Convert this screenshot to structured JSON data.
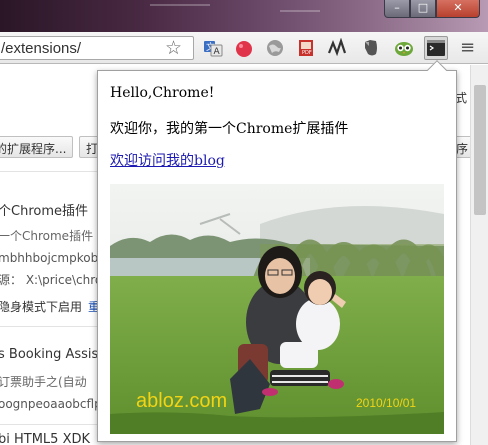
{
  "browser": {
    "url_text": "/extensions/",
    "star_glyph": "☆",
    "menu_glyph": "≡",
    "window_buttons": {
      "minimize": "–",
      "maximize": "□",
      "close": "✕"
    },
    "extension_icons": [
      "translate-icon",
      "red-drop-icon",
      "globe-icon",
      "red-book-icon",
      "vector-icon",
      "evernote-icon",
      "owl-icon",
      "terminal-icon"
    ]
  },
  "background_page": {
    "right_char": "式",
    "buttons": [
      "的扩展程序...",
      "打",
      "序"
    ],
    "items": [
      {
        "title": "个Chrome插件",
        "desc": "一个Chrome插件",
        "id": "mbhhbojcmpkoblcn",
        "source": "源：  X:\\price\\chrom",
        "incognito": "隐身模式下启用",
        "link": "重"
      },
      {
        "title": "s Booking Assista",
        "desc": "订票助手之(自动",
        "id": "oognpeoaaobcflpin"
      },
      {
        "title": "bi HTML5 XDK"
      }
    ]
  },
  "popup": {
    "hello": "Hello,Chrome!",
    "welcome": "欢迎你，我的第一个Chrome扩展插件",
    "blog_link": "欢迎访问我的blog",
    "photo": {
      "watermark": "abloz.com",
      "date_stamp": "2010/10/01"
    }
  },
  "colors": {
    "link": "#1c1ab0",
    "photo_text": "#f2d414"
  }
}
